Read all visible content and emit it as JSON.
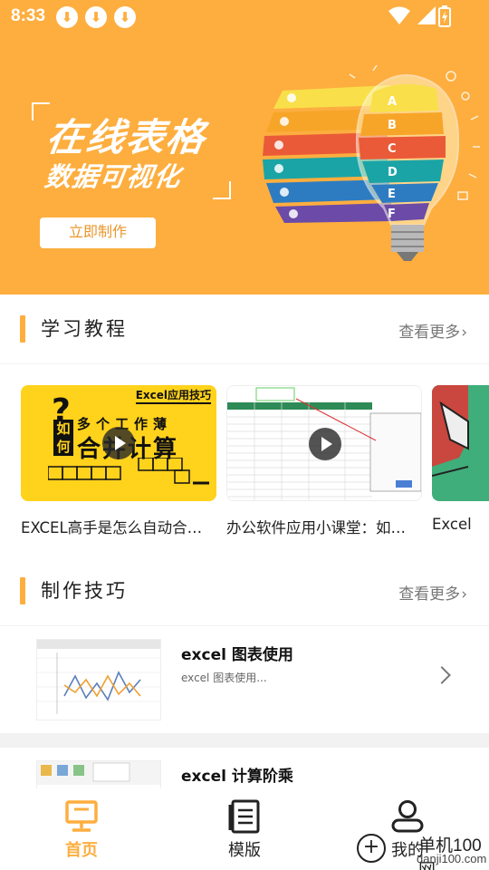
{
  "status_bar": {
    "time": "8:33",
    "download_count": 3
  },
  "banner": {
    "title": "在线表格",
    "subtitle": "数据可视化",
    "cta_label": "立即制作",
    "bulb_letters": [
      "A",
      "B",
      "C",
      "D",
      "E",
      "F"
    ],
    "colors": {
      "background": "#fdae3f",
      "cta_text": "#e9962b"
    }
  },
  "tutorials": {
    "title": "学习教程",
    "more_label": "查看更多",
    "cards": [
      {
        "caption": "EXCEL高手是怎么自动合…",
        "thumb": {
          "tag": "Excel应用技巧",
          "q": "?",
          "ru_he": "如何",
          "line1": "多个工作薄",
          "line2": "合并计算"
        }
      },
      {
        "caption": "办公软件应用小课堂：如…"
      },
      {
        "caption": "Excel"
      }
    ]
  },
  "techniques": {
    "title": "制作技巧",
    "more_label": "查看更多",
    "items": [
      {
        "title": "excel 图表使用",
        "desc": "excel 图表使用..."
      },
      {
        "title": "excel 计算阶乘",
        "desc": ""
      }
    ]
  },
  "bottom_nav": {
    "items": [
      {
        "label": "首页",
        "icon": "monitor-icon",
        "active": true
      },
      {
        "label": "模版",
        "icon": "document-icon",
        "active": false
      },
      {
        "label": "我的",
        "icon": "user-icon",
        "active": false
      }
    ],
    "accent": "#fdae3f"
  },
  "watermark": {
    "line1": "单机100网",
    "line2": "danji100.com"
  }
}
